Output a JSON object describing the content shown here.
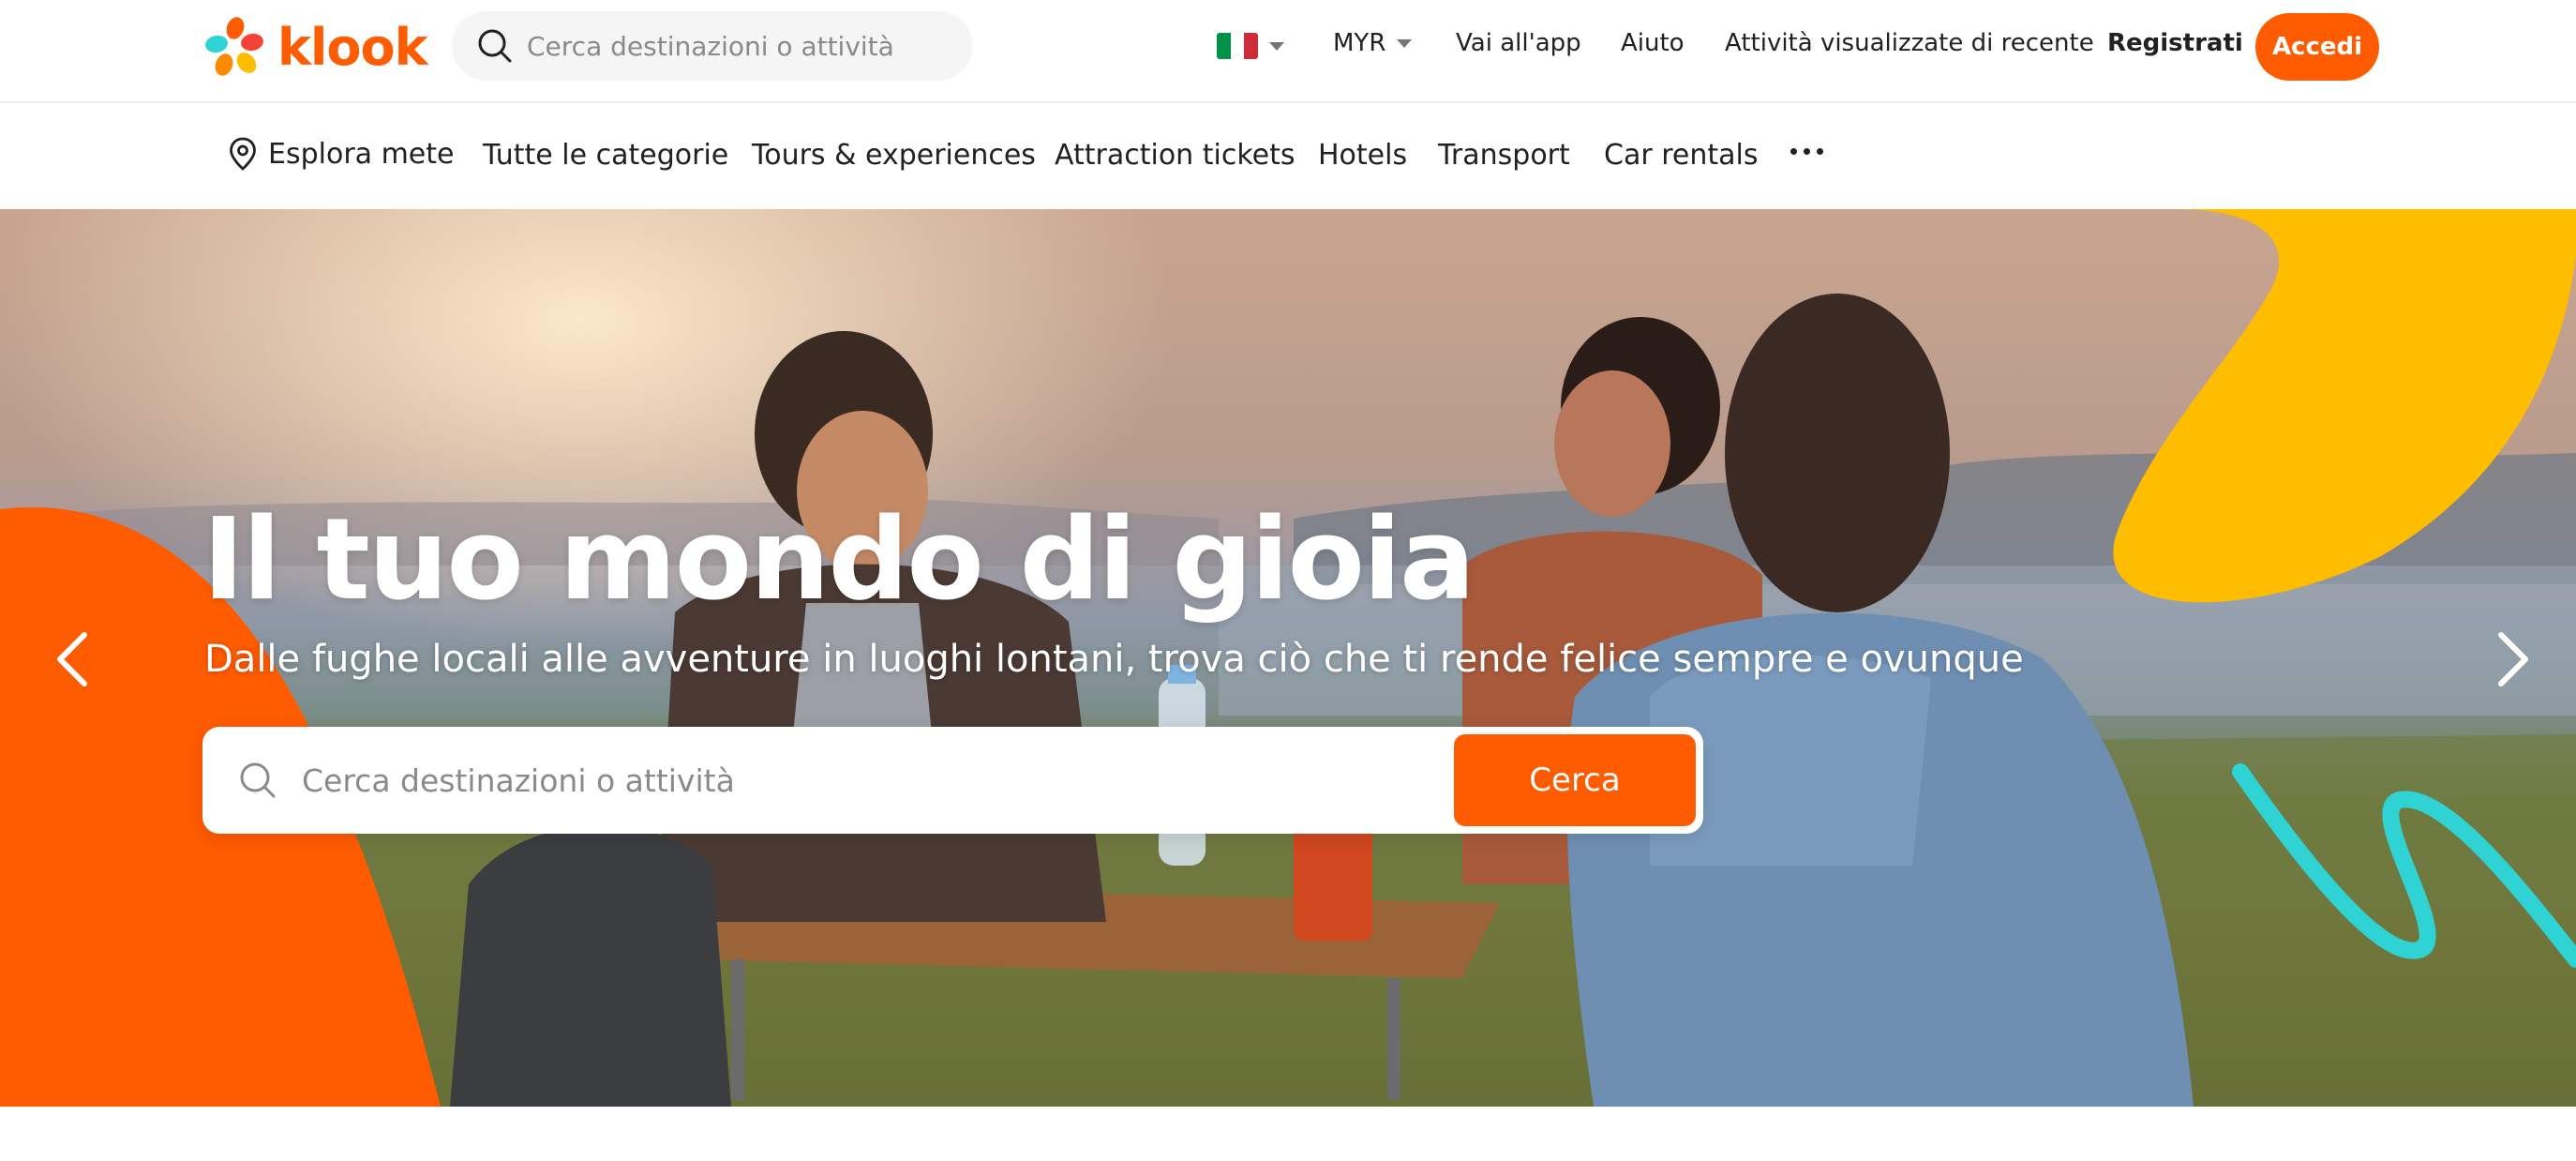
{
  "brand": {
    "name": "klook",
    "accent_color": "#ff5b00"
  },
  "header": {
    "search_placeholder": "Cerca destinazioni o attività",
    "language_flag": "italy-flag-icon",
    "currency": "MYR",
    "links": {
      "app": "Vai all'app",
      "help": "Aiuto",
      "recent": "Attività visualizzate di recente",
      "register": "Registrati"
    },
    "login_label": "Accedi"
  },
  "nav": {
    "explore": "Esplora mete",
    "items": [
      "Tutte le categorie",
      "Tours & experiences",
      "Attraction tickets",
      "Hotels",
      "Transport",
      "Car rentals"
    ],
    "more_icon": "more-horizontal-icon"
  },
  "hero": {
    "title": "Il tuo mondo di gioia",
    "subtitle": "Dalle fughe locali alle avventure in luoghi lontani, trova ciò che ti rende felice sempre e ovunque",
    "search_placeholder": "Cerca destinazioni o attività",
    "search_button": "Cerca",
    "decor_colors": {
      "orange": "#ff5b00",
      "yellow": "#ffbd00",
      "teal": "#2fd3d3"
    }
  }
}
